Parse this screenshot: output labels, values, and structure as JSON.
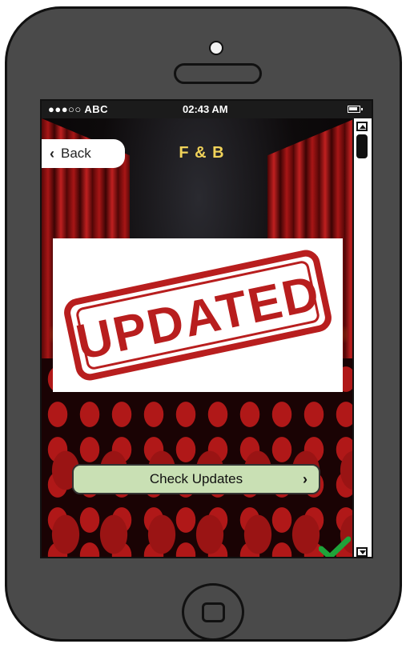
{
  "status_bar": {
    "carrier": "●●●○○ ABC",
    "time": "02:43 AM",
    "battery_icon": "battery-icon"
  },
  "header": {
    "back_label": "Back",
    "back_icon": "chevron-left-icon",
    "title": "F & B"
  },
  "main": {
    "stamp_text": "UPDATED",
    "check_updates_label": "Check Updates",
    "check_updates_icon": "chevron-right-icon",
    "confirm_icon": "checkmark-icon"
  },
  "colors": {
    "title": "#f1d35a",
    "button_bg": "#c9e0b4",
    "stamp": "#b81e1e",
    "check": "#1fa33a",
    "phone_body": "#4a4a4a"
  }
}
